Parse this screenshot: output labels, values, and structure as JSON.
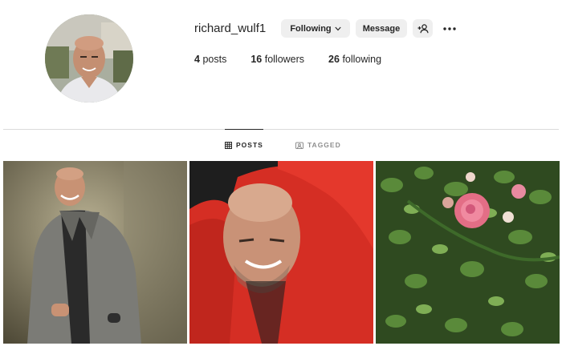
{
  "profile": {
    "username": "richard_wulf1",
    "avatar_icon": "profile-photo",
    "buttons": {
      "following_label": "Following",
      "message_label": "Message",
      "add_user_icon": "add-person-icon",
      "more_icon": "more-horizontal-icon"
    },
    "stats": {
      "posts_count": "4",
      "posts_label": "posts",
      "followers_count": "16",
      "followers_label": "followers",
      "following_count": "26",
      "following_label": "following"
    }
  },
  "tabs": [
    {
      "label": "POSTS",
      "icon": "grid-icon",
      "active": true
    },
    {
      "label": "TAGGED",
      "icon": "tagged-icon",
      "active": false
    }
  ],
  "posts": [
    {
      "subject": "man in grey coat portrait",
      "icon": "post-photo"
    },
    {
      "subject": "man in red hoodie selfie",
      "icon": "post-photo"
    },
    {
      "subject": "pink roses bush",
      "icon": "post-photo"
    }
  ],
  "colors": {
    "button_bg": "#efefef",
    "divider": "#dbdbdb",
    "muted_text": "#8e8e8e",
    "text": "#262626"
  }
}
